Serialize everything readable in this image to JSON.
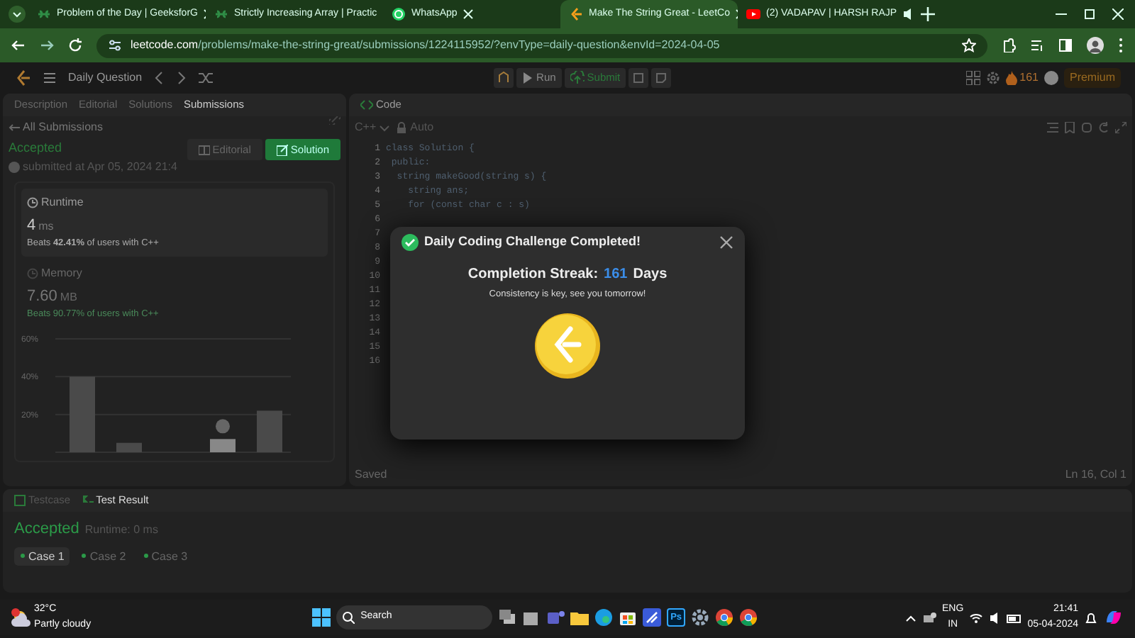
{
  "browser": {
    "tabs": [
      {
        "title": "Problem of the Day | GeeksforG",
        "kind": "gfg",
        "selected": false
      },
      {
        "title": "Strictly Increasing Array | Practic",
        "kind": "gfg",
        "selected": false
      },
      {
        "title": "WhatsApp",
        "kind": "whatsapp",
        "selected": false
      },
      {
        "title": "Make The String Great - LeetCo",
        "kind": "leetcode",
        "selected": true
      },
      {
        "title": "(2) VADAPAV | HARSH RAJP",
        "kind": "youtube",
        "selected": false
      }
    ],
    "url_host": "leetcode.com",
    "url_path": "/problems/make-the-string-great/submissions/1224115952/?envType=daily-question&envId=2024-04-05"
  },
  "header": {
    "title": "Daily Question",
    "run": "Run",
    "submit": "Submit",
    "streak": "161",
    "premium": "Premium"
  },
  "left_panel": {
    "tabs": [
      {
        "label": "Description",
        "selected": false
      },
      {
        "label": "Editorial",
        "selected": false
      },
      {
        "label": "Solutions",
        "selected": false
      },
      {
        "label": "Submissions",
        "selected": true
      }
    ],
    "back": "All Submissions",
    "status": "Accepted",
    "submitted": "submitted at Apr 05, 2024 21:4",
    "editorial": "Editorial",
    "solution": "Solution",
    "runtime": {
      "label": "Runtime",
      "value": "4",
      "unit": "ms",
      "beats": "Beats **42.41%** of users with C++"
    },
    "memory": {
      "label": "Memory",
      "value": "7.60",
      "unit": "MB",
      "beats": "Beats 90.77% of users with C++"
    },
    "chart_data": {
      "type": "bar",
      "values": [
        40,
        5,
        null,
        7,
        22
      ],
      "yticks": [
        {
          "value": 20,
          "label": "20%"
        },
        {
          "value": 40,
          "label": "40%"
        },
        {
          "value": 60,
          "label": "60%"
        }
      ],
      "ylim": [
        0,
        60
      ],
      "grid": true
    }
  },
  "code_panel": {
    "title": "Code",
    "language": "C++",
    "mode": "Auto",
    "line_numbers": [
      "1",
      "2",
      "3",
      "4",
      "5",
      "6",
      "7",
      "8",
      "9",
      "10",
      "11",
      "12",
      "13",
      "14",
      "15",
      "16"
    ],
    "lines": [
      "class Solution {",
      " public:",
      "  string makeGood(string s) {",
      "    string ans;",
      "    for (const char c : s)"
    ],
    "status": "Saved",
    "cursor": "Ln 16, Col 1"
  },
  "result_panel": {
    "tabs": [
      {
        "label": "Testcase",
        "selected": false
      },
      {
        "label": "Test Result",
        "selected": true
      }
    ],
    "status": "Accepted",
    "runtime": "Runtime: 0 ms",
    "cases": [
      {
        "label": "Case 1",
        "selected": true
      },
      {
        "label": "Case 2",
        "selected": false
      },
      {
        "label": "Case 3",
        "selected": false
      }
    ]
  },
  "modal": {
    "title": "Daily Coding Challenge Completed!",
    "streak_label": "Completion Streak:",
    "streak_value": "161",
    "streak_unit": "Days",
    "message": "Consistency is key, see you tomorrow!"
  },
  "taskbar": {
    "temperature": "32°C",
    "weather": "Partly cloudy",
    "search": "Search",
    "apps": [
      {
        "kind": "taskview"
      },
      {
        "kind": "teams"
      },
      {
        "kind": "folder"
      },
      {
        "kind": "edge"
      },
      {
        "kind": "store"
      },
      {
        "kind": "app"
      },
      {
        "kind": "photoshop",
        "label": "Ps"
      },
      {
        "kind": "settings"
      },
      {
        "kind": "chrome"
      },
      {
        "kind": "chrome"
      }
    ],
    "language": "ENG",
    "region": "IN",
    "time": "21:41",
    "date": "05-04-2024"
  }
}
